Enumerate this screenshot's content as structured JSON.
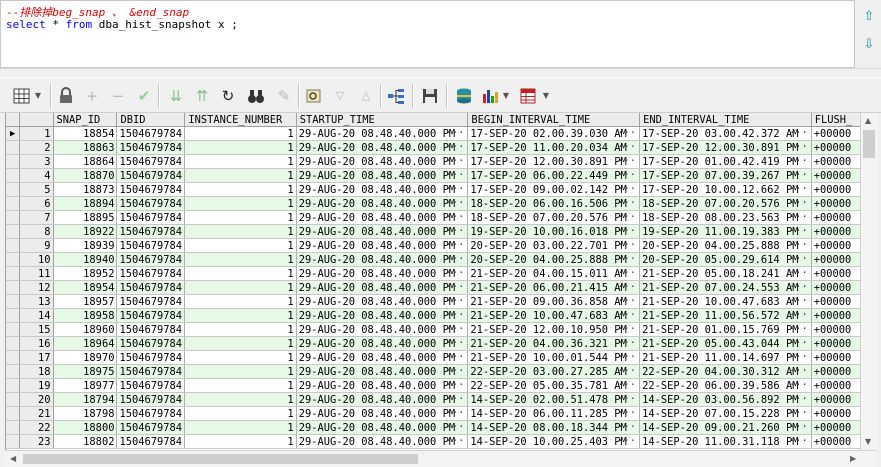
{
  "editor": {
    "comment_line": "--排除掉beg_snap 、 &end_snap",
    "sql_keyword_select": "select",
    "sql_star": " * ",
    "sql_keyword_from": "from",
    "sql_rest": " dba_hist_snapshot x ;"
  },
  "nav": {
    "up": "⇧",
    "down": "⇩"
  },
  "toolbar": {
    "grid_icon": "grid-icon",
    "lock_icon": "lock-icon",
    "add_icon": "plus-icon",
    "remove_icon": "minus-icon",
    "post_icon": "check-icon",
    "filter_down_icon": "double-chevron-down-icon",
    "filter_up_icon": "double-chevron-up-icon",
    "refresh_icon": "refresh-icon",
    "find_icon": "binoculars-icon",
    "clear_icon": "eraser-icon",
    "query_by_example_icon": "query-icon",
    "sort_desc_icon": "triangle-down-icon",
    "sort_asc_icon": "triangle-up-icon",
    "tree_icon": "tree-icon",
    "save_icon": "floppy-icon",
    "export_icon": "database-icon",
    "chart_icon": "bar-chart-icon",
    "table_icon": "table-icon"
  },
  "grid": {
    "columns": [
      "SNAP_ID",
      "DBID",
      "INSTANCE_NUMBER",
      "STARTUP_TIME",
      "BEGIN_INTERVAL_TIME",
      "END_INTERVAL_TIME",
      "FLUSH_"
    ],
    "rows": [
      {
        "n": "1",
        "snap": "18854",
        "dbid": "1504679784",
        "inst": "1",
        "startup": "29-AUG-20 08.48.40.000 PM",
        "begin": "17-SEP-20 02.00.39.030 AM",
        "end": "17-SEP-20 03.00.42.372 AM",
        "flush": "+00000"
      },
      {
        "n": "2",
        "snap": "18863",
        "dbid": "1504679784",
        "inst": "1",
        "startup": "29-AUG-20 08.48.40.000 PM",
        "begin": "17-SEP-20 11.00.20.034 AM",
        "end": "17-SEP-20 12.00.30.891 PM",
        "flush": "+00000"
      },
      {
        "n": "3",
        "snap": "18864",
        "dbid": "1504679784",
        "inst": "1",
        "startup": "29-AUG-20 08.48.40.000 PM",
        "begin": "17-SEP-20 12.00.30.891 PM",
        "end": "17-SEP-20 01.00.42.419 PM",
        "flush": "+00000"
      },
      {
        "n": "4",
        "snap": "18870",
        "dbid": "1504679784",
        "inst": "1",
        "startup": "29-AUG-20 08.48.40.000 PM",
        "begin": "17-SEP-20 06.00.22.449 PM",
        "end": "17-SEP-20 07.00.39.267 PM",
        "flush": "+00000"
      },
      {
        "n": "5",
        "snap": "18873",
        "dbid": "1504679784",
        "inst": "1",
        "startup": "29-AUG-20 08.48.40.000 PM",
        "begin": "17-SEP-20 09.00.02.142 PM",
        "end": "17-SEP-20 10.00.12.662 PM",
        "flush": "+00000"
      },
      {
        "n": "6",
        "snap": "18894",
        "dbid": "1504679784",
        "inst": "1",
        "startup": "29-AUG-20 08.48.40.000 PM",
        "begin": "18-SEP-20 06.00.16.506 PM",
        "end": "18-SEP-20 07.00.20.576 PM",
        "flush": "+00000"
      },
      {
        "n": "7",
        "snap": "18895",
        "dbid": "1504679784",
        "inst": "1",
        "startup": "29-AUG-20 08.48.40.000 PM",
        "begin": "18-SEP-20 07.00.20.576 PM",
        "end": "18-SEP-20 08.00.23.563 PM",
        "flush": "+00000"
      },
      {
        "n": "8",
        "snap": "18922",
        "dbid": "1504679784",
        "inst": "1",
        "startup": "29-AUG-20 08.48.40.000 PM",
        "begin": "19-SEP-20 10.00.16.018 PM",
        "end": "19-SEP-20 11.00.19.383 PM",
        "flush": "+00000"
      },
      {
        "n": "9",
        "snap": "18939",
        "dbid": "1504679784",
        "inst": "1",
        "startup": "29-AUG-20 08.48.40.000 PM",
        "begin": "20-SEP-20 03.00.22.701 PM",
        "end": "20-SEP-20 04.00.25.888 PM",
        "flush": "+00000"
      },
      {
        "n": "10",
        "snap": "18940",
        "dbid": "1504679784",
        "inst": "1",
        "startup": "29-AUG-20 08.48.40.000 PM",
        "begin": "20-SEP-20 04.00.25.888 PM",
        "end": "20-SEP-20 05.00.29.614 PM",
        "flush": "+00000"
      },
      {
        "n": "11",
        "snap": "18952",
        "dbid": "1504679784",
        "inst": "1",
        "startup": "29-AUG-20 08.48.40.000 PM",
        "begin": "21-SEP-20 04.00.15.011 AM",
        "end": "21-SEP-20 05.00.18.241 AM",
        "flush": "+00000"
      },
      {
        "n": "12",
        "snap": "18954",
        "dbid": "1504679784",
        "inst": "1",
        "startup": "29-AUG-20 08.48.40.000 PM",
        "begin": "21-SEP-20 06.00.21.415 AM",
        "end": "21-SEP-20 07.00.24.553 AM",
        "flush": "+00000"
      },
      {
        "n": "13",
        "snap": "18957",
        "dbid": "1504679784",
        "inst": "1",
        "startup": "29-AUG-20 08.48.40.000 PM",
        "begin": "21-SEP-20 09.00.36.858 AM",
        "end": "21-SEP-20 10.00.47.683 AM",
        "flush": "+00000"
      },
      {
        "n": "14",
        "snap": "18958",
        "dbid": "1504679784",
        "inst": "1",
        "startup": "29-AUG-20 08.48.40.000 PM",
        "begin": "21-SEP-20 10.00.47.683 AM",
        "end": "21-SEP-20 11.00.56.572 AM",
        "flush": "+00000"
      },
      {
        "n": "15",
        "snap": "18960",
        "dbid": "1504679784",
        "inst": "1",
        "startup": "29-AUG-20 08.48.40.000 PM",
        "begin": "21-SEP-20 12.00.10.950 PM",
        "end": "21-SEP-20 01.00.15.769 PM",
        "flush": "+00000"
      },
      {
        "n": "16",
        "snap": "18964",
        "dbid": "1504679784",
        "inst": "1",
        "startup": "29-AUG-20 08.48.40.000 PM",
        "begin": "21-SEP-20 04.00.36.321 PM",
        "end": "21-SEP-20 05.00.43.044 PM",
        "flush": "+00000"
      },
      {
        "n": "17",
        "snap": "18970",
        "dbid": "1504679784",
        "inst": "1",
        "startup": "29-AUG-20 08.48.40.000 PM",
        "begin": "21-SEP-20 10.00.01.544 PM",
        "end": "21-SEP-20 11.00.14.697 PM",
        "flush": "+00000"
      },
      {
        "n": "18",
        "snap": "18975",
        "dbid": "1504679784",
        "inst": "1",
        "startup": "29-AUG-20 08.48.40.000 PM",
        "begin": "22-SEP-20 03.00.27.285 AM",
        "end": "22-SEP-20 04.00.30.312 AM",
        "flush": "+00000"
      },
      {
        "n": "19",
        "snap": "18977",
        "dbid": "1504679784",
        "inst": "1",
        "startup": "29-AUG-20 08.48.40.000 PM",
        "begin": "22-SEP-20 05.00.35.781 AM",
        "end": "22-SEP-20 06.00.39.586 AM",
        "flush": "+00000"
      },
      {
        "n": "20",
        "snap": "18794",
        "dbid": "1504679784",
        "inst": "1",
        "startup": "29-AUG-20 08.48.40.000 PM",
        "begin": "14-SEP-20 02.00.51.478 PM",
        "end": "14-SEP-20 03.00.56.892 PM",
        "flush": "+00000"
      },
      {
        "n": "21",
        "snap": "18798",
        "dbid": "1504679784",
        "inst": "1",
        "startup": "29-AUG-20 08.48.40.000 PM",
        "begin": "14-SEP-20 06.00.11.285 PM",
        "end": "14-SEP-20 07.00.15.228 PM",
        "flush": "+00000"
      },
      {
        "n": "22",
        "snap": "18800",
        "dbid": "1504679784",
        "inst": "1",
        "startup": "29-AUG-20 08.48.40.000 PM",
        "begin": "14-SEP-20 08.00.18.344 PM",
        "end": "14-SEP-20 09.00.21.260 PM",
        "flush": "+00000"
      },
      {
        "n": "23",
        "snap": "18802",
        "dbid": "1504679784",
        "inst": "1",
        "startup": "29-AUG-20 08.48.40.000 PM",
        "begin": "14-SEP-20 10.00.25.403 PM",
        "end": "14-SEP-20 11.00.31.118 PM",
        "flush": "+00000"
      }
    ],
    "current_row_marker": "▶",
    "ellipsis": "···"
  },
  "colors": {
    "even_row": "#e6f8e6",
    "comment": "#e00000",
    "keyword": "#0000ff"
  }
}
